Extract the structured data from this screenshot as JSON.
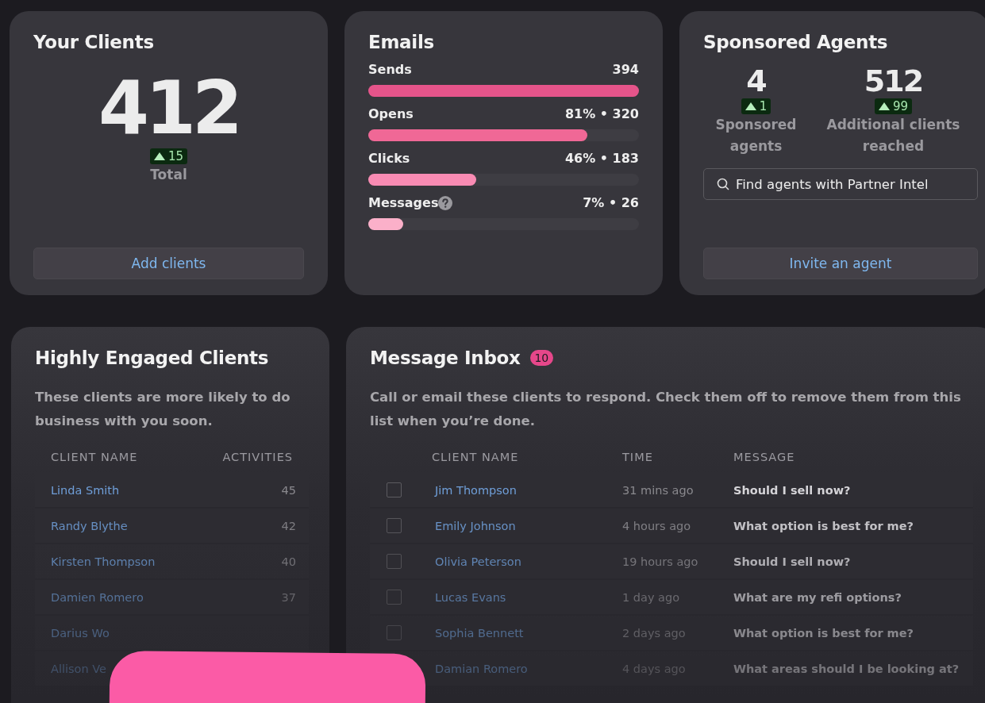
{
  "your_clients": {
    "title": "Your Clients",
    "total": "412",
    "change": "15",
    "label": "Total",
    "button": "Add clients"
  },
  "emails": {
    "title": "Emails",
    "metrics": [
      {
        "label": "Sends",
        "reading": "394",
        "level": 1.0,
        "color": "#e5548a",
        "help": false
      },
      {
        "label": "Opens",
        "reading": "81% • 320",
        "level": 0.81,
        "color": "#f06896",
        "help": false
      },
      {
        "label": "Clicks",
        "reading": "46% • 183",
        "level": 0.4,
        "color": "#f98bb3",
        "help": false
      },
      {
        "label": "Messages",
        "reading": "7% • 26",
        "level": 0.13,
        "color": "#fbb0c9",
        "help": true
      }
    ]
  },
  "sponsored_agents": {
    "title": "Sponsored Agents",
    "stats": [
      {
        "value": "4",
        "change": "1",
        "label": "Sponsored agents"
      },
      {
        "value": "512",
        "change": "99",
        "label": "Additional clients reached"
      }
    ],
    "search": {
      "placeholder": "Find agents with Partner Intel"
    },
    "button": "Invite an agent"
  },
  "highly_engaged": {
    "title": "Highly Engaged Clients",
    "description": "These clients are more likely to do business with you soon.",
    "columns": [
      "CLIENT NAME",
      "ACTIVITIES"
    ],
    "rows": [
      {
        "name": "Linda Smith",
        "activities": "45"
      },
      {
        "name": "Randy Blythe",
        "activities": "42"
      },
      {
        "name": "Kirsten Thompson",
        "activities": "40"
      },
      {
        "name": "Damien Romero",
        "activities": "37"
      },
      {
        "name": "Darius Wo"
      },
      {
        "name": "Allison Ve"
      }
    ]
  },
  "message_inbox": {
    "title": "Message Inbox",
    "count": "10",
    "description": "Call or email these clients to respond. Check them off to remove them from this list when you’re done.",
    "columns": [
      "CLIENT NAME",
      "TIME",
      "MESSAGE"
    ],
    "rows": [
      {
        "checked": false,
        "name": "Jim Thompson",
        "time": "31 mins ago",
        "message": "Should I sell now?"
      },
      {
        "checked": false,
        "name": "Emily Johnson",
        "time": "4 hours ago",
        "message": "What option is best for me?"
      },
      {
        "checked": false,
        "name": "Olivia Peterson",
        "time": "19 hours ago",
        "message": "Should I sell now?"
      },
      {
        "checked": false,
        "name": "Lucas Evans",
        "time": "1 day ago",
        "message": "What are my refi options?"
      },
      {
        "checked": false,
        "name": "Sophia Bennett",
        "time": "2 days ago",
        "message": "What option is best for me?"
      },
      {
        "name": "Damian Romero",
        "time": "4 days ago",
        "message": "What areas should I be looking at?"
      }
    ]
  }
}
